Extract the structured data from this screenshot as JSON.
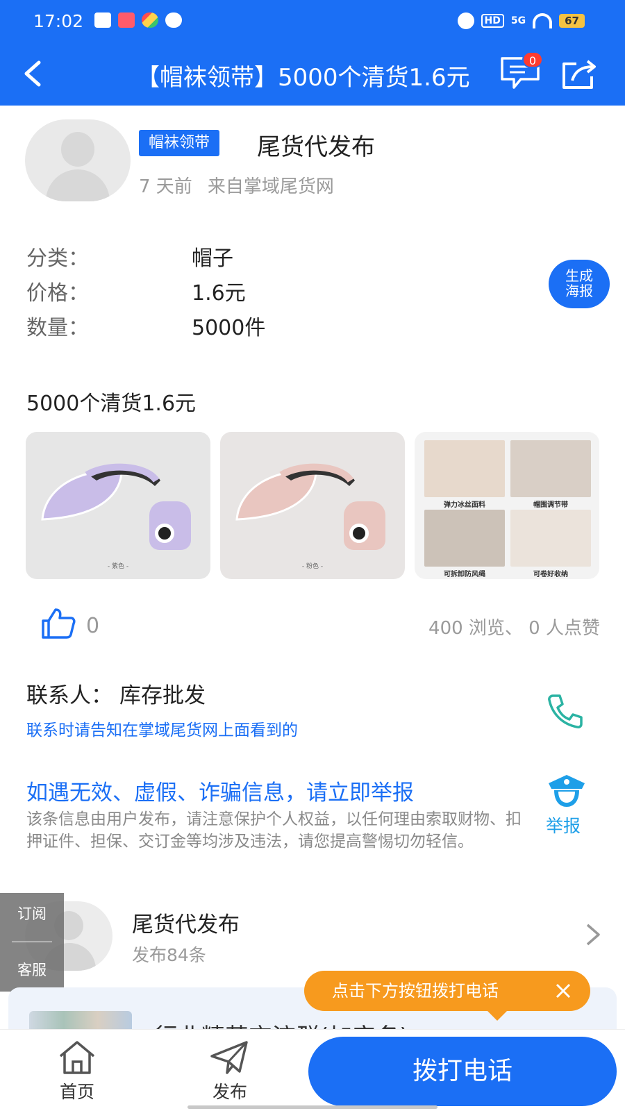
{
  "status_bar": {
    "time": "17:02",
    "network": "5G",
    "hd": "HD",
    "battery": "67"
  },
  "header": {
    "title": "【帽袜领带】5000个清货1.6元",
    "message_count": "0"
  },
  "author": {
    "category_tag": "帽袜领带",
    "name": "尾货代发布",
    "time_ago": "7 天前",
    "source": "来自掌域尾货网"
  },
  "details": [
    {
      "label": "分类：",
      "value": "帽子"
    },
    {
      "label": "价格：",
      "value": "1.6元"
    },
    {
      "label": "数量：",
      "value": "5000件"
    }
  ],
  "poster_button": {
    "line1": "生成",
    "line2": "海报"
  },
  "description": "5000个清货1.6元",
  "gallery": {
    "img1_caption": "- 紫色 -",
    "img2_caption": "- 粉色 -",
    "img3_cells": [
      "弹力冰丝面料",
      "帽围调节带",
      "可拆卸防风绳",
      "可卷好收纳"
    ]
  },
  "stats": {
    "like_count": "0",
    "summary": "400 浏览、 0 人点赞"
  },
  "contact": {
    "label": "联系人：",
    "name": "库存批发",
    "hint": "联系时请告知在掌域尾货网上面看到的"
  },
  "report": {
    "title": "如遇无效、虚假、诈骗信息，请立即举报",
    "text": "该条信息由用户发布，请注意保护个人权益，以任何理由索取财物、扣押证件、担保、交订金等均涉及违法，请您提高警惕切勿轻信。",
    "button_label": "举报"
  },
  "publisher": {
    "name": "尾货代发布",
    "post_count": "发布84条"
  },
  "side_float": {
    "subscribe": "订阅",
    "service": "客服"
  },
  "partial_card": {
    "text": "行业精英交流群(加实名)"
  },
  "tooltip": {
    "text": "点击下方按钮拨打电话"
  },
  "bottom_bar": {
    "home_label": "首页",
    "publish_label": "发布",
    "call_label": "拨打电话"
  },
  "colors": {
    "primary": "#1b6ff5",
    "accent_orange": "#f79a1e",
    "report_blue": "#1e9fe8",
    "phone_teal": "#2bb3a3"
  }
}
